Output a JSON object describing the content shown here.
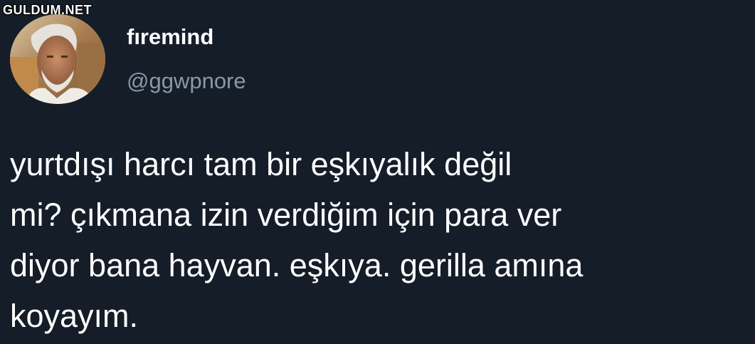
{
  "watermark": "GULDUM.NET",
  "tweet": {
    "display_name": "fıremind",
    "handle": "@ggwpnore",
    "text": "yurtdışı harcı tam bir eşkıyalık değil\nmi? çıkmana izin verdiğim için para ver\ndiyor bana hayvan. eşkıya. gerilla amına\nkoyayım."
  },
  "colors": {
    "background": "#151d29",
    "text": "#ffffff",
    "handle": "#8899a6"
  }
}
